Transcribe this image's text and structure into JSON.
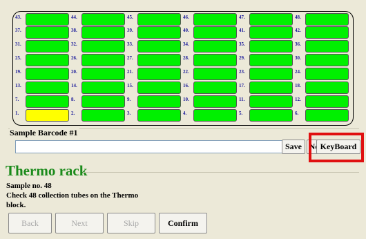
{
  "rack": {
    "rows": [
      [
        "43.",
        "44.",
        "45.",
        "46.",
        "47.",
        "48."
      ],
      [
        "37.",
        "38.",
        "39.",
        "40.",
        "41.",
        "42."
      ],
      [
        "31.",
        "32.",
        "33.",
        "34.",
        "35.",
        "36."
      ],
      [
        "25.",
        "26.",
        "27.",
        "28.",
        "29.",
        "30."
      ],
      [
        "19.",
        "20.",
        "21.",
        "22.",
        "23.",
        "24."
      ],
      [
        "13.",
        "14.",
        "15.",
        "16.",
        "17.",
        "18."
      ],
      [
        "7.",
        "8.",
        "9.",
        "10.",
        "11.",
        "12."
      ],
      [
        "1.",
        "2.",
        "3.",
        "4.",
        "5.",
        "6."
      ]
    ],
    "active_tube": "1.",
    "colors": {
      "filled": "#00f000",
      "active": "#ffff00"
    }
  },
  "barcode": {
    "label": "Sample Barcode #1",
    "value": "",
    "save_label": "Save",
    "new_label": "New",
    "keyboard_label": "KeyBoard"
  },
  "thermo": {
    "title": "Thermo rack",
    "sample_line": "Sample no. 48",
    "instruction_line1": "Check 48 collection tubes on the Thermo",
    "instruction_line2": "block."
  },
  "nav": {
    "back_label": "Back",
    "next_label": "Next",
    "skip_label": "Skip",
    "confirm_label": "Confirm"
  }
}
